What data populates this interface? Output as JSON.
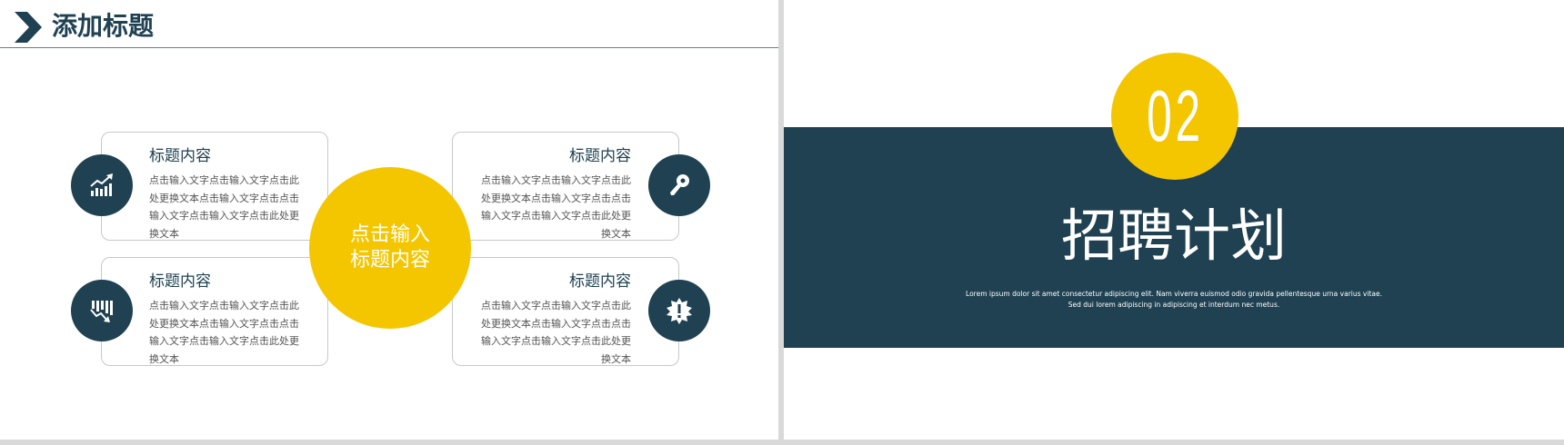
{
  "left_slide": {
    "title": "添加标题",
    "center": {
      "line1": "点击输入",
      "line2": "标题内容"
    },
    "cards": [
      {
        "heading": "标题内容",
        "body": "点击输入文字点击输入文字点击此处更换文本点击输入文字点击点击输入文字点击输入文字点击此处更换文本",
        "icon": "chart-growth-icon"
      },
      {
        "heading": "标题内容",
        "body": "点击输入文字点击输入文字点击此处更换文本点击输入文字点击点击输入文字点击输入文字点击此处更换文本",
        "icon": "key-icon"
      },
      {
        "heading": "标题内容",
        "body": "点击输入文字点击输入文字点击此处更换文本点击输入文字点击点击输入文字点击输入文字点击此处更换文本",
        "icon": "chart-decline-icon"
      },
      {
        "heading": "标题内容",
        "body": "点击输入文字点击输入文字点击此处更换文本点击输入文字点击点击输入文字点击输入文字点击此处更换文本",
        "icon": "alert-badge-icon"
      }
    ]
  },
  "right_slide": {
    "number": "02",
    "title": "招聘计划",
    "description": "Lorem ipsum dolor sit amet consectetur adipiscing elit. Nam viverra euismod odio gravida pellentesque urna varius vitae. Sed dui lorem adipiscing in adipiscing et interdum nec metus."
  },
  "colors": {
    "navy": "#1f4152",
    "yellow": "#f4c600",
    "background": "#ffffff",
    "divider": "#d9d9d9"
  }
}
